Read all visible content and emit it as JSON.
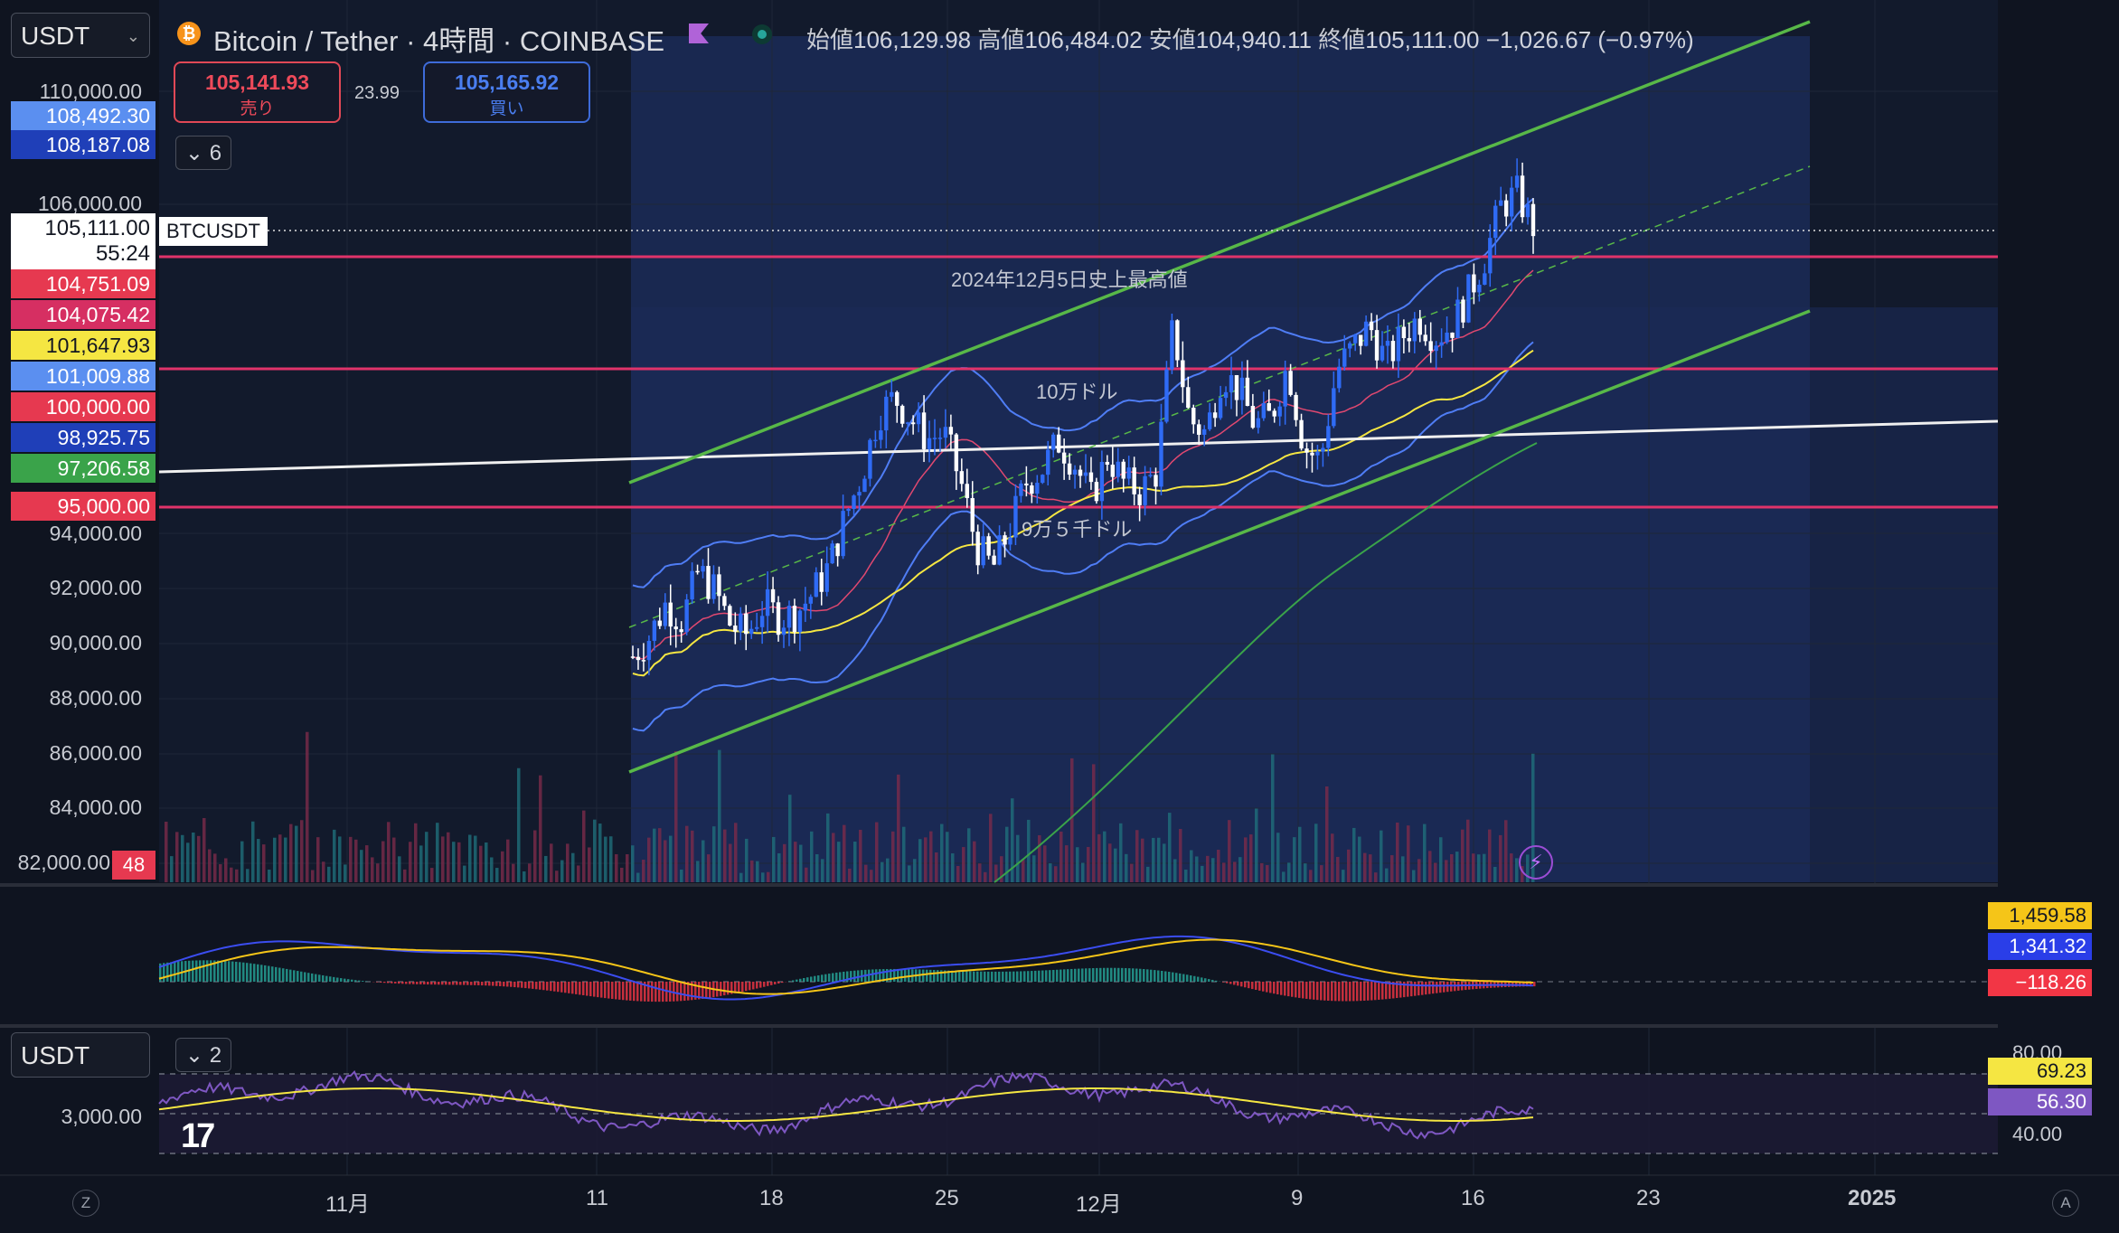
{
  "header": {
    "symbol_select": "USDT",
    "title": "Bitcoin / Tether · 4時間 · COINBASE",
    "ohlc": {
      "open_label": "始値",
      "open": "106,129.98",
      "high_label": "高値",
      "high": "106,484.02",
      "low_label": "安値",
      "low": "104,940.11",
      "close_label": "終値",
      "close": "105,111.00",
      "change": "−1,026.67 (−0.97%)"
    }
  },
  "trade": {
    "sell_price": "105,141.93",
    "sell_label": "売り",
    "spread": "23.99",
    "buy_price": "105,165.92",
    "buy_label": "買い"
  },
  "collapse_count": "6",
  "price_tags": [
    {
      "text": "108,492.30",
      "color": "#5b8ff0"
    },
    {
      "text": "108,187.08",
      "color": "#1f3fb8"
    },
    {
      "text": "104,751.09",
      "color": "#e63950"
    },
    {
      "text": "104,075.42",
      "color": "#d62f62"
    },
    {
      "text": "101,647.93",
      "color": "#f5e642"
    },
    {
      "text": "101,009.88",
      "color": "#5b8ff0"
    },
    {
      "text": "100,000.00",
      "color": "#e63950"
    },
    {
      "text": "98,925.75",
      "color": "#1f3fb8"
    },
    {
      "text": "97,206.58",
      "color": "#3aa34a"
    },
    {
      "text": "95,000.00",
      "color": "#e63950"
    }
  ],
  "current_price": {
    "price": "105,111.00",
    "countdown": "55:24",
    "symbol_label": "BTCUSDT"
  },
  "y_axis": [
    "110,000.00",
    "106,000.00",
    "94,000.00",
    "92,000.00",
    "90,000.00",
    "88,000.00",
    "86,000.00",
    "84,000.00",
    "82,000.00"
  ],
  "y_badge": "48",
  "x_axis": [
    "11月",
    "11",
    "18",
    "25",
    "12月",
    "9",
    "16",
    "23",
    "2025"
  ],
  "annotations": {
    "ath": "2024年12月5日史上最高値",
    "level_100k": "10万ドル",
    "level_95k": "9万５千ドル"
  },
  "macd": {
    "signal": "1,459.58",
    "macd": "1,341.32",
    "hist": "−118.26",
    "colors": {
      "signal": "#f5c518",
      "macd": "#2a3ee8",
      "hist": "#f23645"
    }
  },
  "rsi": {
    "select": "USDT",
    "collapse_count": "2",
    "axis_left": "3,000.00",
    "upper": "80.00",
    "lower": "40.00",
    "ma": "69.23",
    "value": "56.30",
    "colors": {
      "ma": "#f5e642",
      "value": "#7e57c2"
    }
  },
  "chart_data": {
    "type": "candlestick",
    "title": "Bitcoin / Tether · 4時間 · COINBASE",
    "ylim": [
      82000,
      110000
    ],
    "horizontal_levels": [
      104075.42,
      100000,
      95000
    ],
    "path_points": [
      [
        0,
        89500
      ],
      [
        1,
        90200
      ],
      [
        2,
        91400
      ],
      [
        3,
        90800
      ],
      [
        4,
        92600
      ],
      [
        5,
        91900
      ],
      [
        6,
        90600
      ],
      [
        7,
        90300
      ],
      [
        8,
        91400
      ],
      [
        9,
        90900
      ],
      [
        10,
        91100
      ],
      [
        11,
        91800
      ],
      [
        12,
        92800
      ],
      [
        13,
        94600
      ],
      [
        14,
        96100
      ],
      [
        15,
        98300
      ],
      [
        16,
        98900
      ],
      [
        17,
        98100
      ],
      [
        18,
        97400
      ],
      [
        19,
        97600
      ],
      [
        20,
        95900
      ],
      [
        21,
        93500
      ],
      [
        22,
        92700
      ],
      [
        23,
        94100
      ],
      [
        24,
        95800
      ],
      [
        25,
        96300
      ],
      [
        26,
        97300
      ],
      [
        27,
        96500
      ],
      [
        28,
        95200
      ],
      [
        29,
        96800
      ],
      [
        30,
        95800
      ],
      [
        31,
        95500
      ],
      [
        32,
        96200
      ],
      [
        33,
        101500
      ],
      [
        34,
        98100
      ],
      [
        35,
        97600
      ],
      [
        36,
        99800
      ],
      [
        37,
        99200
      ],
      [
        38,
        97900
      ],
      [
        39,
        98200
      ],
      [
        40,
        100100
      ],
      [
        41,
        97100
      ],
      [
        42,
        96600
      ],
      [
        43,
        99900
      ],
      [
        44,
        100700
      ],
      [
        45,
        101500
      ],
      [
        46,
        100200
      ],
      [
        47,
        101100
      ],
      [
        48,
        101800
      ],
      [
        49,
        101100
      ],
      [
        50,
        101500
      ],
      [
        51,
        102600
      ],
      [
        52,
        103900
      ],
      [
        53,
        105800
      ],
      [
        54,
        106300
      ],
      [
        55,
        105100
      ]
    ]
  }
}
